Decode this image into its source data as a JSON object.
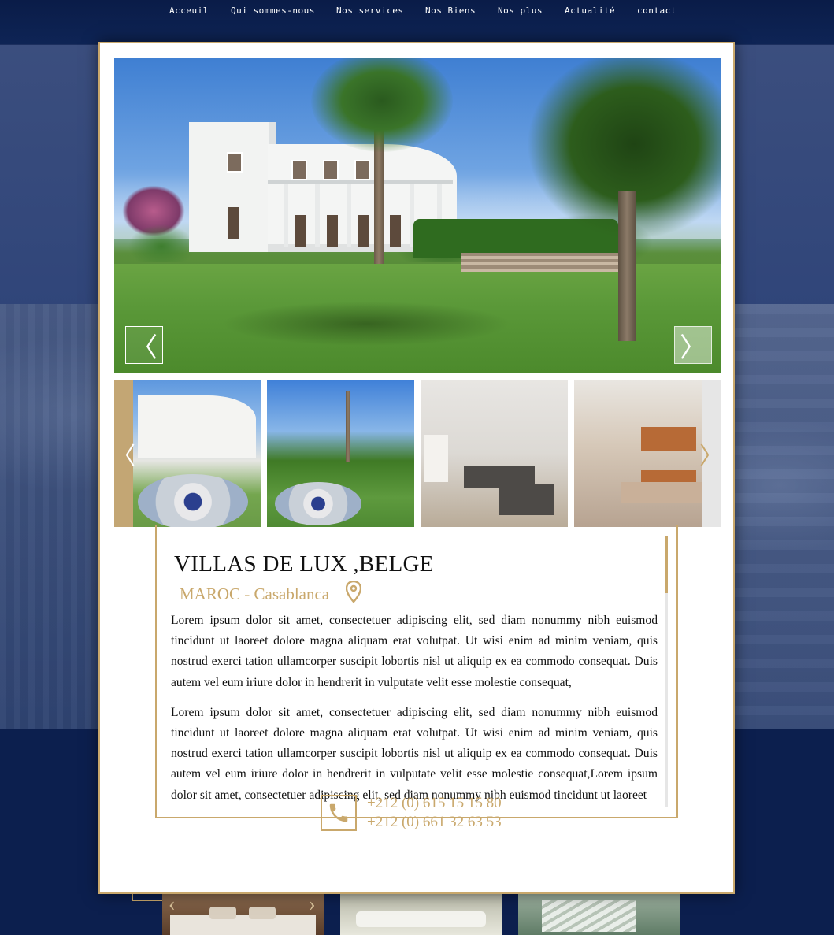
{
  "nav": {
    "items": [
      "Acceuil",
      "Qui sommes-nous",
      "Nos services",
      "Nos Biens",
      "Nos plus",
      "Actualité",
      "contact"
    ]
  },
  "hero": {
    "prev_arrow": "〈",
    "next_arrow": "〉"
  },
  "thumbnails": {
    "prev_arrow": "〈",
    "next_arrow": "〉"
  },
  "property": {
    "title": "VILLAS DE LUX ,BELGE",
    "location": "MAROC - Casablanca",
    "paragraphs": [
      "Lorem ipsum dolor sit amet, consectetuer adipiscing elit, sed diam nonummy nibh euismod tincidunt ut laoreet dolore magna aliquam erat volutpat. Ut wisi enim ad minim veniam, quis nostrud exerci tation ullamcorper suscipit lobortis nisl ut aliquip ex ea commodo consequat. Duis autem vel eum iriure dolor in hendrerit in vulputate velit esse molestie consequat,",
      "Lorem ipsum dolor sit amet, consectetuer adipiscing elit, sed diam nonummy nibh euismod tincidunt ut laoreet dolore magna aliquam erat volutpat. Ut wisi enim ad minim veniam, quis nostrud exerci tation ullamcorper suscipit lobortis nisl ut aliquip ex ea commodo consequat. Duis autem vel eum iriure dolor in hendrerit in vulputate velit esse molestie consequat,Lorem ipsum dolor sit amet, consectetuer adipiscing elit, sed diam nonummy nibh euismod tincidunt ut laoreet"
    ]
  },
  "contact": {
    "phones": [
      "+212 (0) 615 15 15 80",
      "+212 (0) 661 32 63 53"
    ]
  },
  "colors": {
    "navy": "#0c1f4e",
    "gold": "#c9a86c"
  }
}
